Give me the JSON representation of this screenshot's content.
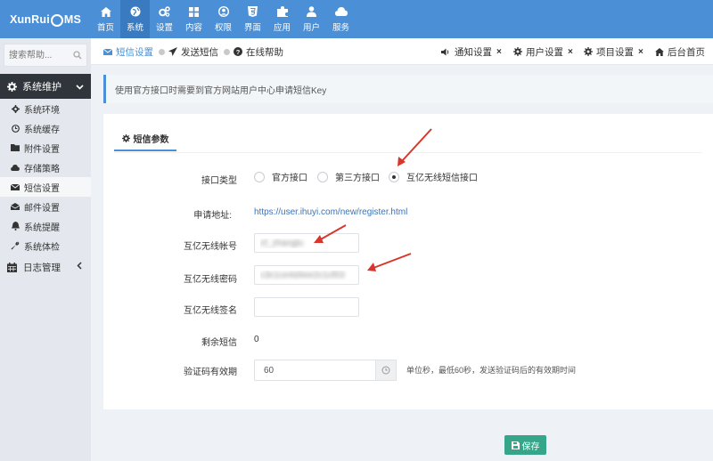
{
  "app": {
    "logo_text": "XunRui",
    "logo_suffix": "MS"
  },
  "topnav": [
    {
      "label": "首页",
      "icon": "home-icon"
    },
    {
      "label": "系统",
      "icon": "globe-icon",
      "active": true
    },
    {
      "label": "设置",
      "icon": "cogs-icon"
    },
    {
      "label": "内容",
      "icon": "grid-icon"
    },
    {
      "label": "权限",
      "icon": "user-circle-icon"
    },
    {
      "label": "界面",
      "icon": "html5-icon"
    },
    {
      "label": "应用",
      "icon": "puzzle-icon"
    },
    {
      "label": "用户",
      "icon": "user-icon"
    },
    {
      "label": "服务",
      "icon": "cloud-icon"
    }
  ],
  "sidebar": {
    "search_placeholder": "搜索帮助...",
    "section": "系统维护",
    "items": [
      {
        "label": "系统环境",
        "icon": "gear-icon"
      },
      {
        "label": "系统缓存",
        "icon": "clock-icon"
      },
      {
        "label": "附件设置",
        "icon": "folder-icon"
      },
      {
        "label": "存储策略",
        "icon": "cloud-icon"
      },
      {
        "label": "短信设置",
        "icon": "envelope-icon",
        "active": true
      },
      {
        "label": "邮件设置",
        "icon": "envelope-open-icon"
      },
      {
        "label": "系统提醒",
        "icon": "bell-icon"
      },
      {
        "label": "系统体检",
        "icon": "wrench-icon"
      }
    ],
    "log_section": "日志管理"
  },
  "tabs": {
    "left": [
      {
        "label": "短信设置",
        "icon": "envelope-icon",
        "active": true
      },
      {
        "label": "发送短信",
        "icon": "send-icon"
      },
      {
        "label": "在线帮助",
        "icon": "question-icon"
      }
    ],
    "right": [
      {
        "label": "通知设置",
        "icon": "volume-icon"
      },
      {
        "label": "用户设置",
        "icon": "gear-icon"
      },
      {
        "label": "项目设置",
        "icon": "gear-icon"
      },
      {
        "label": "后台首页",
        "icon": "home-icon"
      }
    ]
  },
  "alert": "使用官方接口时需要到官方网站用户中心申请短信Key",
  "panel": {
    "tab_label": "短信参数",
    "interface_label": "接口类型",
    "interface_options": [
      "官方接口",
      "第三方接口",
      "互亿无线短信接口"
    ],
    "interface_selected": "互亿无线短信接口",
    "apply_url_label": "申请地址:",
    "apply_url": "https://user.ihuyi.com/new/register.html",
    "account_label": "互亿无线帐号",
    "account_value": "cf_zhanglu",
    "password_label": "互亿无线密码",
    "password_value": "c3c1ce4d4ee2c1cf03",
    "sign_label": "互亿无线签名",
    "sign_value": "",
    "remaining_label": "剩余短信",
    "remaining_value": "0",
    "validity_label": "验证码有效期",
    "validity_value": "60",
    "validity_hint": "单位秒，最低60秒，发送验证码后的有效期时间"
  },
  "save_label": "保存",
  "colors": {
    "topbar": "#4b8fd6",
    "accent": "#4b8fd6",
    "save": "#36a58a",
    "arrow": "#d9352b"
  }
}
